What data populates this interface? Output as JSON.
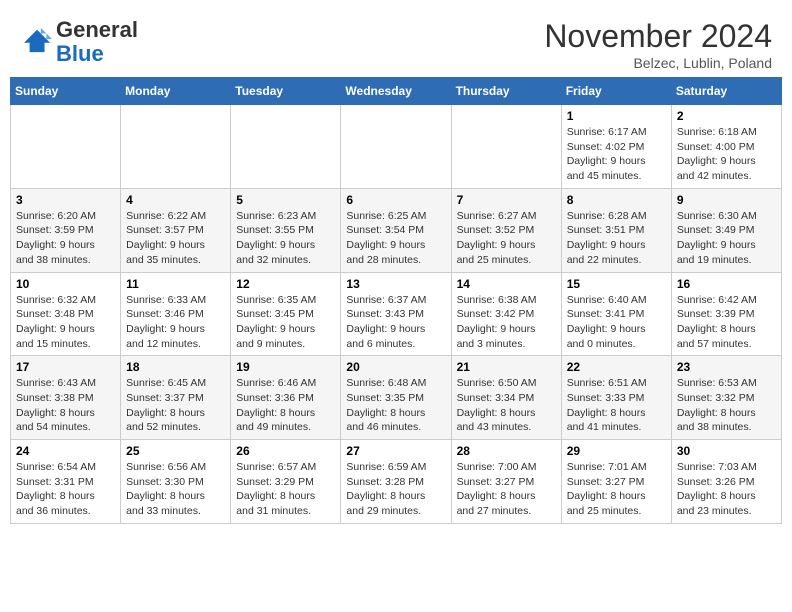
{
  "logo": {
    "text_general": "General",
    "text_blue": "Blue"
  },
  "title": {
    "month": "November 2024",
    "location": "Belzec, Lublin, Poland"
  },
  "weekdays": [
    "Sunday",
    "Monday",
    "Tuesday",
    "Wednesday",
    "Thursday",
    "Friday",
    "Saturday"
  ],
  "weeks": [
    [
      {
        "day": "",
        "info": ""
      },
      {
        "day": "",
        "info": ""
      },
      {
        "day": "",
        "info": ""
      },
      {
        "day": "",
        "info": ""
      },
      {
        "day": "",
        "info": ""
      },
      {
        "day": "1",
        "info": "Sunrise: 6:17 AM\nSunset: 4:02 PM\nDaylight: 9 hours and 45 minutes."
      },
      {
        "day": "2",
        "info": "Sunrise: 6:18 AM\nSunset: 4:00 PM\nDaylight: 9 hours and 42 minutes."
      }
    ],
    [
      {
        "day": "3",
        "info": "Sunrise: 6:20 AM\nSunset: 3:59 PM\nDaylight: 9 hours and 38 minutes."
      },
      {
        "day": "4",
        "info": "Sunrise: 6:22 AM\nSunset: 3:57 PM\nDaylight: 9 hours and 35 minutes."
      },
      {
        "day": "5",
        "info": "Sunrise: 6:23 AM\nSunset: 3:55 PM\nDaylight: 9 hours and 32 minutes."
      },
      {
        "day": "6",
        "info": "Sunrise: 6:25 AM\nSunset: 3:54 PM\nDaylight: 9 hours and 28 minutes."
      },
      {
        "day": "7",
        "info": "Sunrise: 6:27 AM\nSunset: 3:52 PM\nDaylight: 9 hours and 25 minutes."
      },
      {
        "day": "8",
        "info": "Sunrise: 6:28 AM\nSunset: 3:51 PM\nDaylight: 9 hours and 22 minutes."
      },
      {
        "day": "9",
        "info": "Sunrise: 6:30 AM\nSunset: 3:49 PM\nDaylight: 9 hours and 19 minutes."
      }
    ],
    [
      {
        "day": "10",
        "info": "Sunrise: 6:32 AM\nSunset: 3:48 PM\nDaylight: 9 hours and 15 minutes."
      },
      {
        "day": "11",
        "info": "Sunrise: 6:33 AM\nSunset: 3:46 PM\nDaylight: 9 hours and 12 minutes."
      },
      {
        "day": "12",
        "info": "Sunrise: 6:35 AM\nSunset: 3:45 PM\nDaylight: 9 hours and 9 minutes."
      },
      {
        "day": "13",
        "info": "Sunrise: 6:37 AM\nSunset: 3:43 PM\nDaylight: 9 hours and 6 minutes."
      },
      {
        "day": "14",
        "info": "Sunrise: 6:38 AM\nSunset: 3:42 PM\nDaylight: 9 hours and 3 minutes."
      },
      {
        "day": "15",
        "info": "Sunrise: 6:40 AM\nSunset: 3:41 PM\nDaylight: 9 hours and 0 minutes."
      },
      {
        "day": "16",
        "info": "Sunrise: 6:42 AM\nSunset: 3:39 PM\nDaylight: 8 hours and 57 minutes."
      }
    ],
    [
      {
        "day": "17",
        "info": "Sunrise: 6:43 AM\nSunset: 3:38 PM\nDaylight: 8 hours and 54 minutes."
      },
      {
        "day": "18",
        "info": "Sunrise: 6:45 AM\nSunset: 3:37 PM\nDaylight: 8 hours and 52 minutes."
      },
      {
        "day": "19",
        "info": "Sunrise: 6:46 AM\nSunset: 3:36 PM\nDaylight: 8 hours and 49 minutes."
      },
      {
        "day": "20",
        "info": "Sunrise: 6:48 AM\nSunset: 3:35 PM\nDaylight: 8 hours and 46 minutes."
      },
      {
        "day": "21",
        "info": "Sunrise: 6:50 AM\nSunset: 3:34 PM\nDaylight: 8 hours and 43 minutes."
      },
      {
        "day": "22",
        "info": "Sunrise: 6:51 AM\nSunset: 3:33 PM\nDaylight: 8 hours and 41 minutes."
      },
      {
        "day": "23",
        "info": "Sunrise: 6:53 AM\nSunset: 3:32 PM\nDaylight: 8 hours and 38 minutes."
      }
    ],
    [
      {
        "day": "24",
        "info": "Sunrise: 6:54 AM\nSunset: 3:31 PM\nDaylight: 8 hours and 36 minutes."
      },
      {
        "day": "25",
        "info": "Sunrise: 6:56 AM\nSunset: 3:30 PM\nDaylight: 8 hours and 33 minutes."
      },
      {
        "day": "26",
        "info": "Sunrise: 6:57 AM\nSunset: 3:29 PM\nDaylight: 8 hours and 31 minutes."
      },
      {
        "day": "27",
        "info": "Sunrise: 6:59 AM\nSunset: 3:28 PM\nDaylight: 8 hours and 29 minutes."
      },
      {
        "day": "28",
        "info": "Sunrise: 7:00 AM\nSunset: 3:27 PM\nDaylight: 8 hours and 27 minutes."
      },
      {
        "day": "29",
        "info": "Sunrise: 7:01 AM\nSunset: 3:27 PM\nDaylight: 8 hours and 25 minutes."
      },
      {
        "day": "30",
        "info": "Sunrise: 7:03 AM\nSunset: 3:26 PM\nDaylight: 8 hours and 23 minutes."
      }
    ]
  ]
}
